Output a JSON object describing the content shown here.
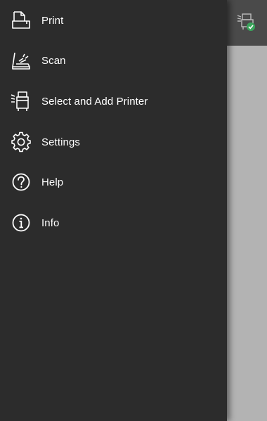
{
  "drawer": {
    "items": [
      {
        "label": "Print",
        "icon": "print-icon"
      },
      {
        "label": "Scan",
        "icon": "scan-icon"
      },
      {
        "label": "Select and Add Printer",
        "icon": "printer-icon"
      },
      {
        "label": "Settings",
        "icon": "gear-icon"
      },
      {
        "label": "Help",
        "icon": "help-icon"
      },
      {
        "label": "Info",
        "icon": "info-icon"
      }
    ]
  },
  "appbar": {
    "printer_status": "connected"
  },
  "colors": {
    "drawer_bg": "#2c2c2c",
    "appbar_bg": "#4a4a4a",
    "scrim": "#b3b3b3",
    "label": "#ffffff",
    "status_ok": "#3aa35b"
  }
}
